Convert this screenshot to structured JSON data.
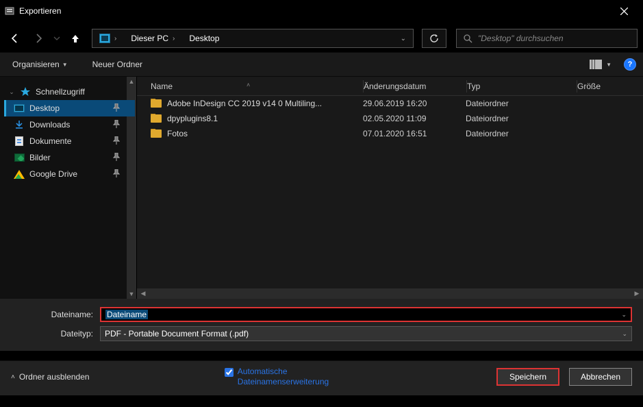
{
  "titlebar": {
    "title": "Exportieren"
  },
  "breadcrumb": {
    "seg1": "Dieser PC",
    "seg2": "Desktop"
  },
  "search": {
    "placeholder": "\"Desktop\" durchsuchen"
  },
  "toolbar": {
    "organize": "Organisieren",
    "new_folder": "Neuer Ordner"
  },
  "sidebar": {
    "quick": "Schnellzugriff",
    "desktop": "Desktop",
    "downloads": "Downloads",
    "documents": "Dokumente",
    "pictures": "Bilder",
    "gdrive": "Google Drive"
  },
  "columns": {
    "name": "Name",
    "date": "Änderungsdatum",
    "type": "Typ",
    "size": "Größe"
  },
  "rows": [
    {
      "name": "Adobe InDesign CC 2019 v14 0 Multiling...",
      "date": "29.06.2019 16:20",
      "type": "Dateiordner"
    },
    {
      "name": "dpyplugins8.1",
      "date": "02.05.2020 11:09",
      "type": "Dateiordner"
    },
    {
      "name": "Fotos",
      "date": "07.01.2020 16:51",
      "type": "Dateiordner"
    }
  ],
  "form": {
    "filename_label": "Dateiname:",
    "filename_value": "Dateiname",
    "filetype_label": "Dateityp:",
    "filetype_value": "PDF - Portable Document Format (.pdf)"
  },
  "footer": {
    "hide_folders": "Ordner ausblenden",
    "auto_ext": "Automatische Dateinamenserweiterung",
    "save": "Speichern",
    "cancel": "Abbrechen"
  }
}
